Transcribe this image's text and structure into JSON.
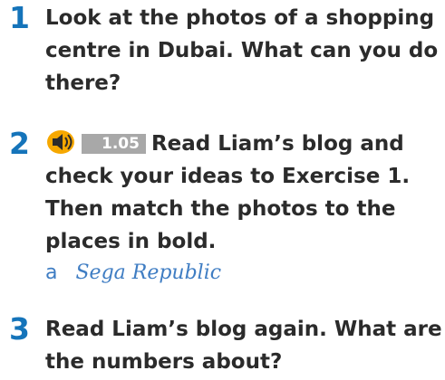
{
  "colors": {
    "number": "#1574ba",
    "text": "#2b2b2b",
    "answer": "#3f7dc3",
    "track_bg": "#a8a8a8",
    "icon_fill": "#f6a800"
  },
  "exercises": [
    {
      "number": "1",
      "lines": [
        "Look at the photos of a shopping",
        "centre in Dubai. What can you do",
        "there?"
      ]
    },
    {
      "number": "2",
      "icon": "speaker-icon",
      "track": "1.05",
      "lines": [
        "Read Liam’s blog and",
        "check your ideas to Exercise 1.",
        "Then match the photos to the",
        "places in bold."
      ],
      "answer": {
        "letter": "a",
        "text": "Sega Republic"
      }
    },
    {
      "number": "3",
      "lines": [
        "Read Liam’s blog again. What are",
        "the numbers about?"
      ]
    }
  ]
}
